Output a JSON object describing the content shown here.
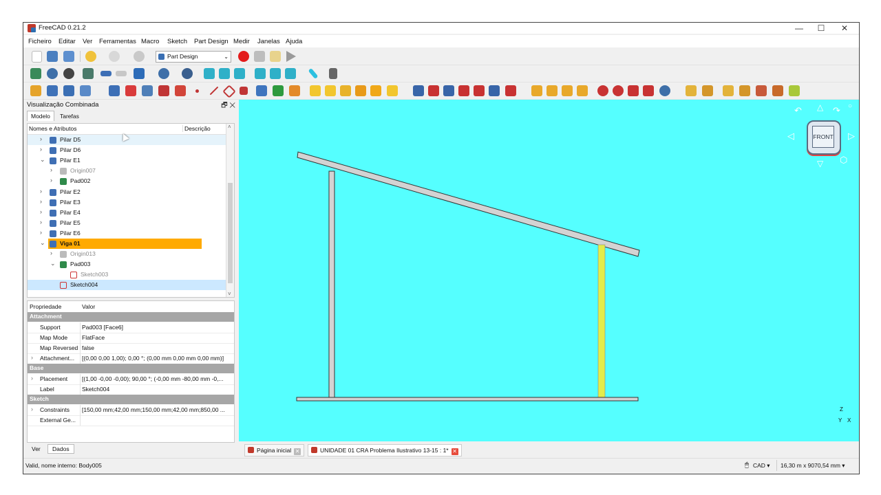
{
  "window": {
    "title": "FreeCAD 0.21.2",
    "controls": [
      "—",
      "☐",
      "✕"
    ]
  },
  "menu": [
    "Ficheiro",
    "Editar",
    "Ver",
    "Ferramentas",
    "Macro",
    "Sketch",
    "Part Design",
    "Medir",
    "Janelas",
    "Ajuda"
  ],
  "toolbar": {
    "workbench": "Part Design"
  },
  "panel": {
    "title": "Visualização Combinada",
    "tabs": [
      "Modelo",
      "Tarefas"
    ],
    "tree_header": {
      "name": "Nomes e Atributos",
      "desc": "Descrição"
    },
    "tree": [
      {
        "label": "Pilar D5",
        "twisty": "›",
        "indent": 0,
        "icon": "body",
        "style": "hover"
      },
      {
        "label": "Pilar D6",
        "twisty": "›",
        "indent": 0,
        "icon": "body",
        "style": ""
      },
      {
        "label": "Pilar E1",
        "twisty": "⌄",
        "indent": 0,
        "icon": "body",
        "style": ""
      },
      {
        "label": "Origin007",
        "twisty": "›",
        "indent": 1,
        "icon": "origin",
        "style": "gray"
      },
      {
        "label": "Pad002",
        "twisty": "›",
        "indent": 1,
        "icon": "pad",
        "style": ""
      },
      {
        "label": "Pilar E2",
        "twisty": "›",
        "indent": 0,
        "icon": "body",
        "style": ""
      },
      {
        "label": "Pilar E3",
        "twisty": "›",
        "indent": 0,
        "icon": "body",
        "style": ""
      },
      {
        "label": "Pilar E4",
        "twisty": "›",
        "indent": 0,
        "icon": "body",
        "style": ""
      },
      {
        "label": "Pilar E5",
        "twisty": "›",
        "indent": 0,
        "icon": "body",
        "style": ""
      },
      {
        "label": "Pilar E6",
        "twisty": "›",
        "indent": 0,
        "icon": "body",
        "style": ""
      },
      {
        "label": "Viga 01",
        "twisty": "⌄",
        "indent": 0,
        "icon": "body",
        "style": "active"
      },
      {
        "label": "Origin013",
        "twisty": "›",
        "indent": 1,
        "icon": "origin",
        "style": "gray"
      },
      {
        "label": "Pad003",
        "twisty": "⌄",
        "indent": 1,
        "icon": "pad",
        "style": ""
      },
      {
        "label": "Sketch003",
        "twisty": "",
        "indent": 2,
        "icon": "sketch",
        "style": "gray"
      },
      {
        "label": "Sketch004",
        "twisty": "",
        "indent": 1,
        "icon": "sketch",
        "style": "selected"
      }
    ],
    "props_header": {
      "key": "Propriedade",
      "value": "Valor"
    },
    "props": [
      {
        "group": "Attachment"
      },
      {
        "key": "Support",
        "value": "Pad003 [Face6]"
      },
      {
        "key": "Map Mode",
        "value": "FlatFace"
      },
      {
        "key": "Map Reversed",
        "value": "false"
      },
      {
        "key": "Attachment...",
        "value": "[(0,00 0,00 1,00); 0,00 °; (0,00 mm  0,00 mm  0,00 mm)]",
        "twisty": true
      },
      {
        "group": "Base"
      },
      {
        "key": "Placement",
        "value": "[(1,00 -0,00 -0,00); 90,00 °; (-0,00 mm  -80,00 mm  -0,...",
        "twisty": true
      },
      {
        "key": "Label",
        "value": "Sketch004"
      },
      {
        "group": "Sketch"
      },
      {
        "key": "Constraints",
        "value": "[150,00 mm;42,00 mm;150,00 mm;42,00 mm;850,00 ...",
        "twisty": true
      },
      {
        "key": "External Ge...",
        "value": ""
      }
    ],
    "bottom_tabs": [
      "Ver",
      "Dados"
    ]
  },
  "navcube": {
    "face": "FRONT"
  },
  "axis": {
    "z": "Z",
    "y": "Y",
    "x": "X"
  },
  "doc_tabs": [
    {
      "label": "Página inicial",
      "close_style": "gray"
    },
    {
      "label": "UNIDADE 01 CRA Problema Ilustrativo 13-15 : 1*",
      "close_style": "red"
    }
  ],
  "status": {
    "left": "Valid, nome interno: Body005",
    "nav": "CAD ▾",
    "dims": "16,30 m x 9070,54 mm ▾"
  },
  "colors": {
    "viewport": "#55ffff",
    "active_item": "#ffaa00",
    "selected_item": "#cce8ff",
    "selected_beam": "#e3ec4a"
  }
}
